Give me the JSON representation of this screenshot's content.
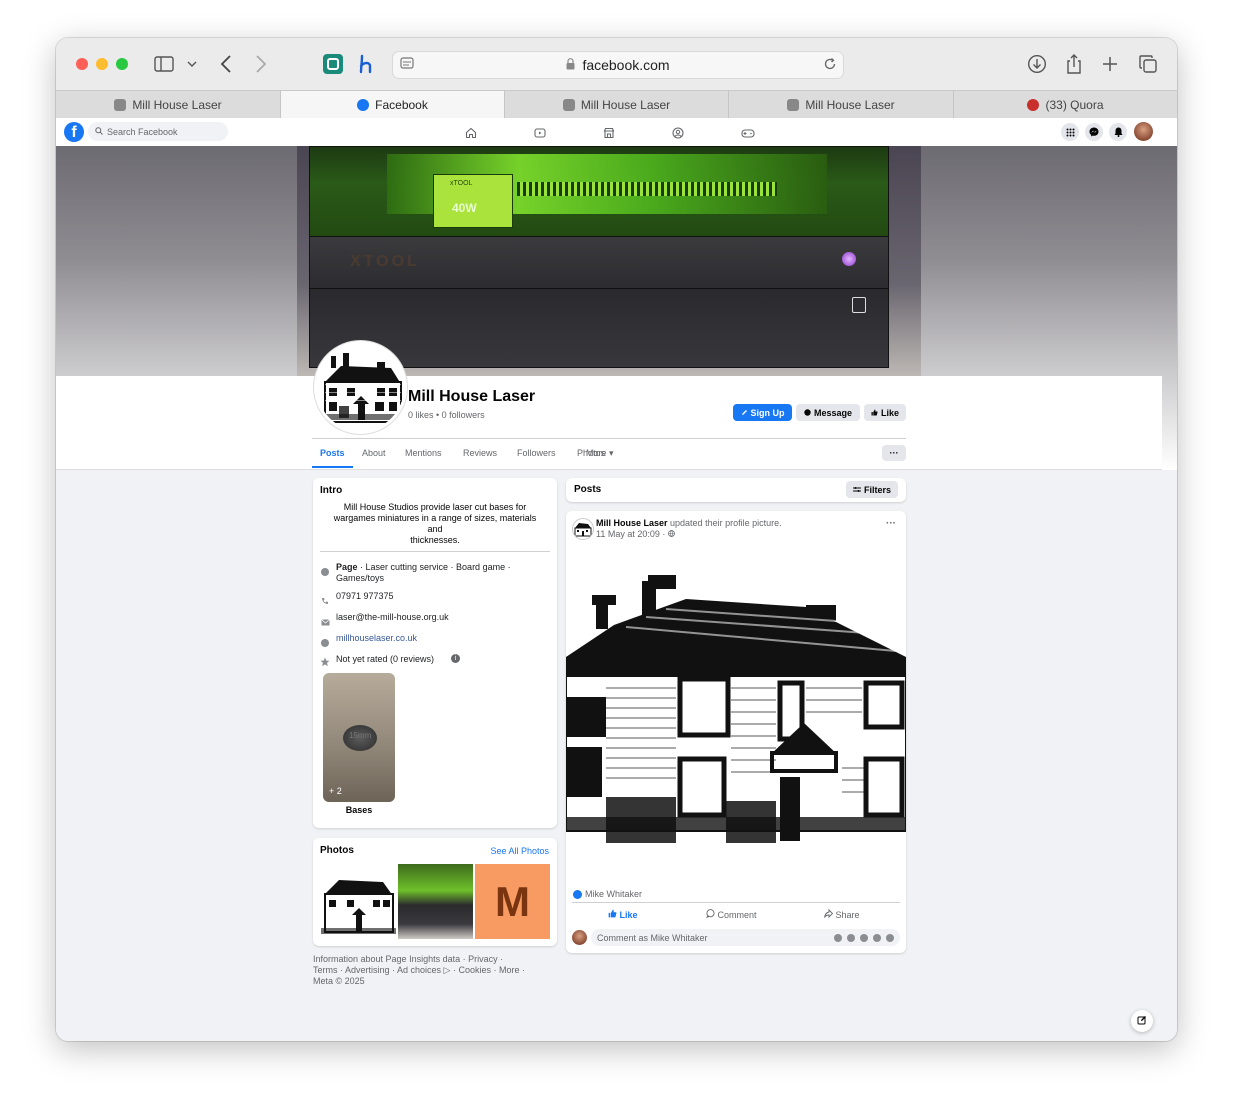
{
  "browser": {
    "url": "facebook.com",
    "tabs": [
      {
        "label": "Mill House Laser",
        "active": false
      },
      {
        "label": "Facebook",
        "active": true
      },
      {
        "label": "Mill House Laser",
        "active": false
      },
      {
        "label": "Mill House Laser",
        "active": false
      },
      {
        "label": "(33) Quora",
        "active": false
      }
    ]
  },
  "fb": {
    "search_placeholder": "Search Facebook",
    "brand_color": "#1877f2"
  },
  "page": {
    "name": "Mill House Laser",
    "stats": "0 likes • 0 followers",
    "buttons": {
      "signup": "Sign Up",
      "message": "Message",
      "like": "Like"
    },
    "tabs": [
      "Posts",
      "About",
      "Mentions",
      "Reviews",
      "Followers",
      "Photos",
      "More"
    ],
    "more_dots": "···",
    "cover_texts": {
      "brand": "xTOOL",
      "badge": "40W",
      "panel": "XTOOL"
    }
  },
  "intro": {
    "title": "Intro",
    "description_lines": [
      "Mill House Studios provide laser cut bases for",
      "wargames miniatures in a range of sizes, materials",
      "and",
      "thicknesses."
    ],
    "page_label": "Page",
    "page_categories": " · Laser cutting service · Board game ·",
    "page_categories_2": "Games/toys",
    "phone": "07971 977375",
    "email": "laser@the-mill-house.org.uk",
    "website": "millhouselaser.co.uk",
    "rating": "Not yet rated (0 reviews)",
    "featured_count": "+ 2",
    "featured_label": "Bases",
    "coin_text": "15mm"
  },
  "photos": {
    "title": "Photos",
    "see_all": "See All Photos",
    "thumb_letter": "M"
  },
  "footer": {
    "line1a": "Information about Page Insights data",
    "line1b": " · ",
    "line1c": "Privacy",
    "line1d": " ·",
    "line2": "Terms · Advertising · Ad choices ▷ · Cookies · More ·",
    "line3": "Meta © 2025"
  },
  "posts": {
    "header": "Posts",
    "filters": "Filters",
    "post": {
      "author": "Mill House Laser",
      "action": " updated their profile picture.",
      "date": "11 May at 20:09 · ",
      "liker": "Mike Whitaker",
      "actions": {
        "like": "Like",
        "comment": "Comment",
        "share": "Share"
      },
      "comment_placeholder": "Comment as Mike Whitaker"
    }
  }
}
